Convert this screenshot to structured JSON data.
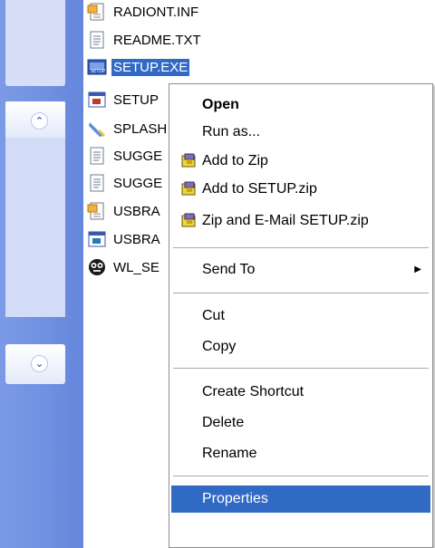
{
  "files": [
    {
      "name": "RADIONT.INF",
      "icon": "inf-file-icon"
    },
    {
      "name": "README.TXT",
      "icon": "text-file-icon"
    },
    {
      "name": "SETUP.EXE",
      "icon": "exe-file-icon",
      "selected": true
    },
    {
      "name": "SETUP",
      "icon": "app-window-icon"
    },
    {
      "name": "SPLASH",
      "icon": "image-file-icon"
    },
    {
      "name": "SUGGE",
      "icon": "text-file-icon"
    },
    {
      "name": "SUGGE",
      "icon": "text-file-icon"
    },
    {
      "name": "USBRA",
      "icon": "inf-file-icon"
    },
    {
      "name": "USBRA",
      "icon": "app-window-icon"
    },
    {
      "name": "WL_SE",
      "icon": "wl-app-icon"
    }
  ],
  "context_menu": {
    "open": "Open",
    "run_as": "Run as...",
    "add_to_zip": "Add to Zip",
    "add_to_setup_zip": "Add to SETUP.zip",
    "zip_and_email": "Zip and E-Mail SETUP.zip",
    "send_to": "Send To",
    "cut": "Cut",
    "copy": "Copy",
    "create_shortcut": "Create Shortcut",
    "delete": "Delete",
    "rename": "Rename",
    "properties": "Properties"
  },
  "colors": {
    "selection": "#316ac5",
    "task_pane": "#6f8fe0"
  },
  "icons": {
    "collapse": "chevron-up-icon",
    "expand": "chevron-down-icon",
    "submenu": "submenu-arrow-icon",
    "zip": "winzip-icon"
  }
}
